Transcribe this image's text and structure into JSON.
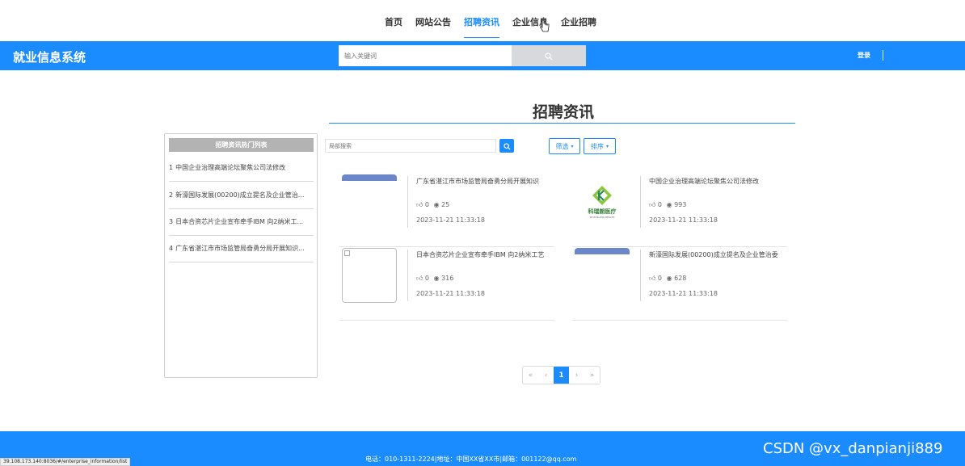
{
  "topnav": {
    "items": [
      {
        "label": "首页"
      },
      {
        "label": "网站公告"
      },
      {
        "label": "招聘资讯"
      },
      {
        "label": "企业信息"
      },
      {
        "label": "企业招聘"
      }
    ],
    "active_index": 2
  },
  "header": {
    "brand": "就业信息系统",
    "search_placeholder": "输入关键词",
    "login": "登录"
  },
  "page": {
    "title": "招聘资讯"
  },
  "hot_list": {
    "title": "招聘资讯热门列表",
    "items": [
      {
        "num": "1",
        "text": "中国企业治理高端论坛聚焦公司法修改"
      },
      {
        "num": "2",
        "text": "新濠国际发展(00200)成立提名及企业管治..."
      },
      {
        "num": "3",
        "text": "日本合资芯片企业宣布牵手IBM 向2纳米工..."
      },
      {
        "num": "4",
        "text": "广东省湛江市市场监管局奋勇分局开展知识..."
      }
    ]
  },
  "filter": {
    "placeholder": "局部搜索",
    "filter_label": "筛选",
    "sort_label": "排序"
  },
  "cards": [
    {
      "title": "广东省湛江市市场监管局奋勇分局开展知识",
      "likes": "0",
      "views": "25",
      "date": "2023-11-21 11:33:18"
    },
    {
      "title": "中国企业治理高端论坛聚焦公司法修改",
      "likes": "0",
      "views": "993",
      "date": "2023-11-21 11:33:18",
      "logo_text": "科瑞朗医疗",
      "logo_sub": "KE RUILANG HEALTH"
    },
    {
      "title": "日本合资芯片企业宣布牵手IBM 向2纳米工艺",
      "likes": "0",
      "views": "316",
      "date": "2023-11-21 11:33:18"
    },
    {
      "title": "新濠国际发展(00200)成立提名及企业管治委",
      "likes": "0",
      "views": "628",
      "date": "2023-11-21 11:33:18"
    }
  ],
  "pager": {
    "first": "«",
    "prev": "‹",
    "current": "1",
    "next": "›",
    "last": "»"
  },
  "footer": {
    "info": "电话：010-1311-2224|地址：中国XX省XX市|邮箱：001122@qq.com",
    "watermark": "CSDN @vx_danpianji889"
  },
  "statusbar": {
    "url": "39.108.173.140:8036/#/enterprise_information/list"
  },
  "colors": {
    "accent": "#1a8cff",
    "header_bg": "#1a8cff"
  }
}
